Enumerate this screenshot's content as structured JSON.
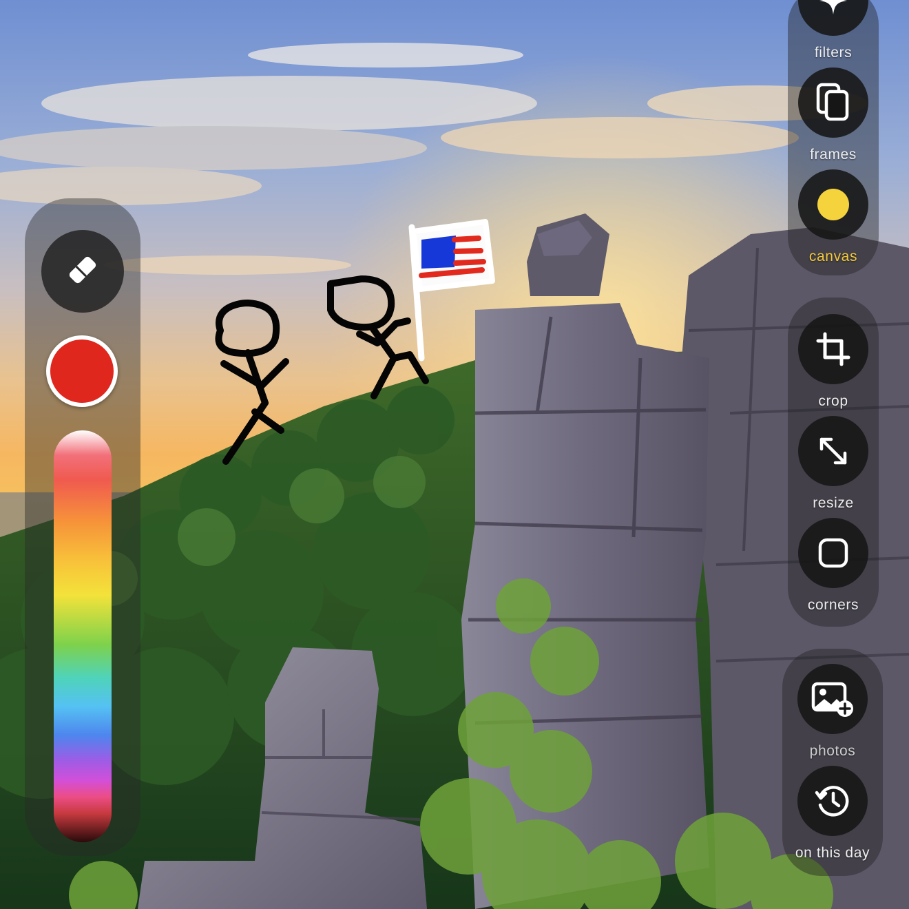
{
  "toolbar": {
    "filters_label": "filters",
    "frames_label": "frames",
    "canvas_label": "canvas",
    "crop_label": "crop",
    "resize_label": "resize",
    "corners_label": "corners",
    "photos_label": "photos",
    "on_this_day_label": "on this day"
  },
  "icons": {
    "filters": "sparkle-icon",
    "frames": "frames-icon",
    "canvas": "canvas-color-dot-icon",
    "crop": "crop-icon",
    "resize": "resize-arrows-icon",
    "corners": "rounded-square-icon",
    "photos": "add-photo-icon",
    "on_this_day": "history-clock-icon",
    "eraser": "eraser-icon"
  },
  "palette": {
    "selected_color": "#e0271e",
    "canvas_color": "#f5d33c",
    "active_label_color": "#f3c93b"
  },
  "photo": {
    "subject": "sunset over rock pillars and forested hillside with doodled stick figures holding a flag"
  }
}
